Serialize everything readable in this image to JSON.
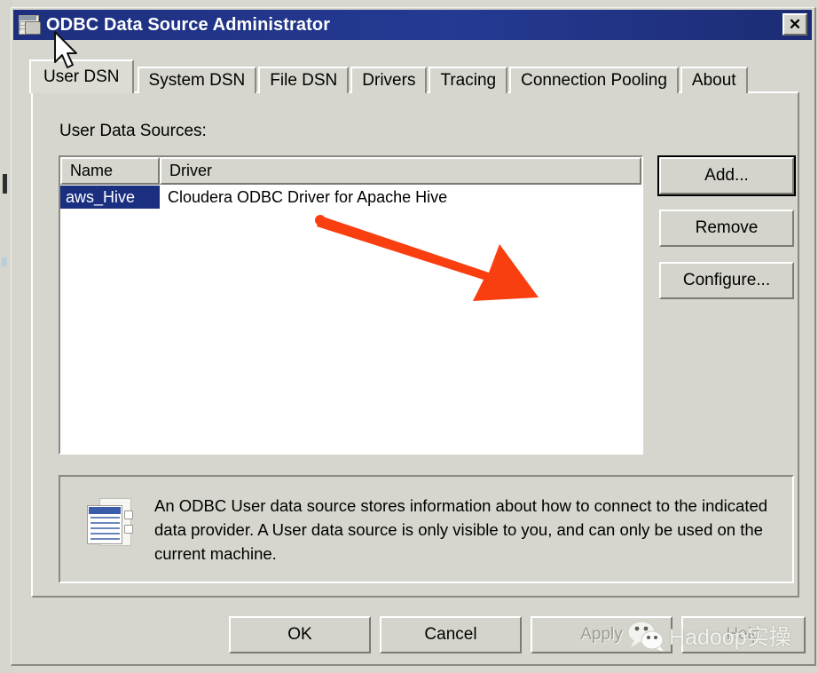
{
  "window": {
    "title": "ODBC Data Source Administrator",
    "icon": "odbc-database-icon",
    "close_label": "✕"
  },
  "tabs": [
    {
      "label": "User DSN",
      "active": true
    },
    {
      "label": "System DSN",
      "active": false
    },
    {
      "label": "File DSN",
      "active": false
    },
    {
      "label": "Drivers",
      "active": false
    },
    {
      "label": "Tracing",
      "active": false
    },
    {
      "label": "Connection Pooling",
      "active": false
    },
    {
      "label": "About",
      "active": false
    }
  ],
  "user_dsn": {
    "section_label": "User Data Sources:",
    "columns": [
      "Name",
      "Driver"
    ],
    "rows": [
      {
        "name": "aws_Hive",
        "driver": "Cloudera ODBC Driver for Apache Hive",
        "selected": true
      }
    ],
    "side_buttons": [
      {
        "label": "Add...",
        "focused": true,
        "enabled": true
      },
      {
        "label": "Remove",
        "focused": false,
        "enabled": true
      },
      {
        "label": "Configure...",
        "focused": false,
        "enabled": true
      }
    ],
    "info": {
      "icon": "data-source-document-icon",
      "text": "An ODBC User data source stores information about how to connect to the indicated data provider.   A User data source is only visible to you, and can only be used on the current machine."
    }
  },
  "dialog_buttons": [
    {
      "label": "OK",
      "enabled": true
    },
    {
      "label": "Cancel",
      "enabled": true
    },
    {
      "label": "Apply",
      "enabled": false
    },
    {
      "label": "Help",
      "enabled": true
    }
  ],
  "annotation": {
    "type": "arrow",
    "color": "#f93f10",
    "direction": "down-right"
  },
  "watermark": {
    "logo": "wechat-icon",
    "text": "Hadoop实操",
    "color": "#f4f4f0"
  },
  "cursor": {
    "type": "arrow-pointer"
  },
  "colors": {
    "titlebar": "#20307f",
    "face": "#d6d6ce",
    "selection": "#1b2f80",
    "accent_arrow": "#f93f10"
  }
}
